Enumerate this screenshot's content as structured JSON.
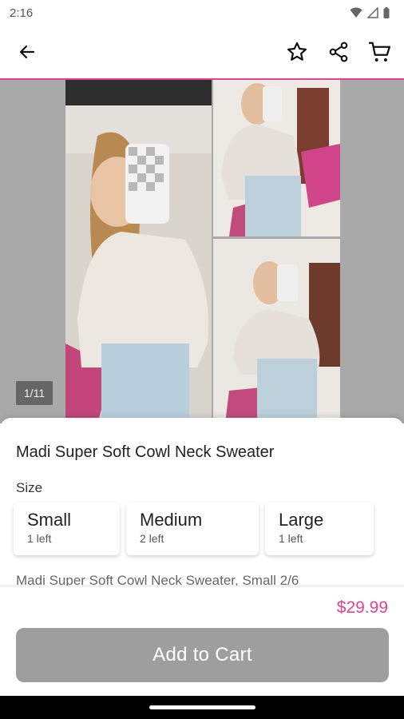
{
  "status_bar": {
    "time": "2:16"
  },
  "app_bar": {
    "back_icon": "arrow-left-icon",
    "favorite_icon": "star-outline-icon",
    "share_icon": "share-icon",
    "cart_icon": "cart-icon",
    "accent_color": "#e6408e"
  },
  "gallery": {
    "counter": "1/11"
  },
  "product": {
    "title": "Madi Super Soft Cowl Neck Sweater",
    "size_label": "Size",
    "sizes": [
      {
        "name": "Small",
        "stock": "1 left"
      },
      {
        "name": "Medium",
        "stock": "2 left"
      },
      {
        "name": "Large",
        "stock": "1 left"
      }
    ],
    "description": "Madi Super Soft Cowl Neck Sweater, Small 2/6",
    "price": "$29.99",
    "price_color": "#e6408e"
  },
  "actions": {
    "add_to_cart": "Add to Cart",
    "button_color": "#9e9e9e"
  }
}
